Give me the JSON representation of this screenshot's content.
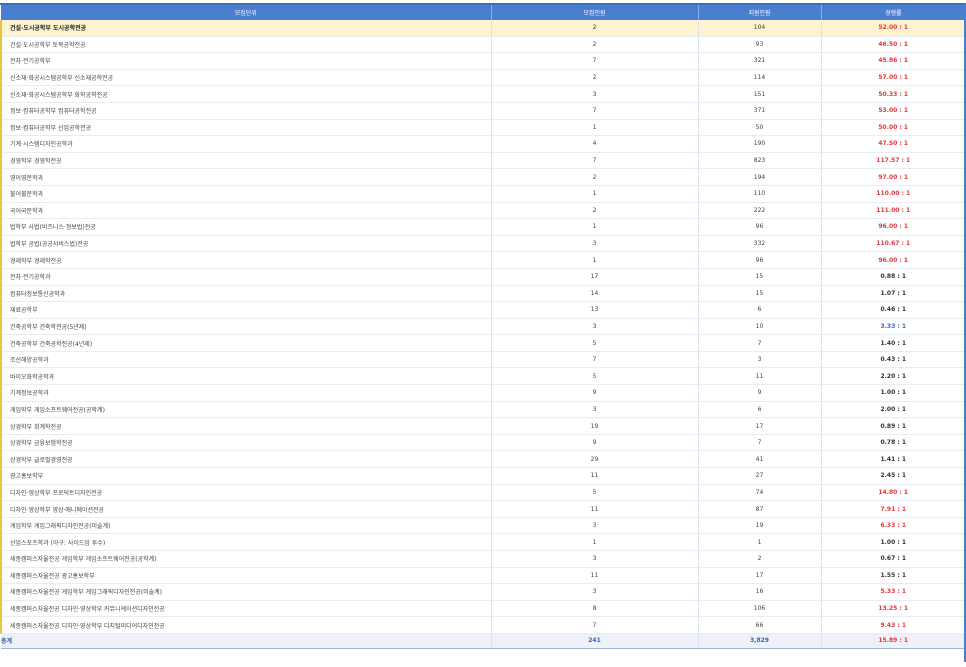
{
  "table": {
    "headers": [
      "모집단위",
      "모집인원",
      "지원인원",
      "경쟁률"
    ],
    "rows": [
      {
        "name": "건설·도시공학부 도시공학전공",
        "quota": "2",
        "applicants": "104",
        "ratio": "52.00 : 1",
        "ratio_color": "red",
        "highlight": true
      },
      {
        "name": "건설·도시공학부 토목공학전공",
        "quota": "2",
        "applicants": "93",
        "ratio": "46.50 : 1",
        "ratio_color": "red"
      },
      {
        "name": "전자·전기공학부",
        "quota": "7",
        "applicants": "321",
        "ratio": "45.86 : 1",
        "ratio_color": "red"
      },
      {
        "name": "신소재·화공시스템공학부 신소재공학전공",
        "quota": "2",
        "applicants": "114",
        "ratio": "57.00 : 1",
        "ratio_color": "red"
      },
      {
        "name": "신소재·화공시스템공학부 화학공학전공",
        "quota": "3",
        "applicants": "151",
        "ratio": "50.33 : 1",
        "ratio_color": "red"
      },
      {
        "name": "정보·컴퓨터공학부 컴퓨터공학전공",
        "quota": "7",
        "applicants": "371",
        "ratio": "53.00 : 1",
        "ratio_color": "red"
      },
      {
        "name": "정보·컴퓨터공학부 산업공학전공",
        "quota": "1",
        "applicants": "50",
        "ratio": "50.00 : 1",
        "ratio_color": "red"
      },
      {
        "name": "기계·시스템디자인공학과",
        "quota": "4",
        "applicants": "190",
        "ratio": "47.50 : 1",
        "ratio_color": "red"
      },
      {
        "name": "경영학부 경영학전공",
        "quota": "7",
        "applicants": "823",
        "ratio": "117.57 : 1",
        "ratio_color": "red",
        "group_start": true
      },
      {
        "name": "영어영문학과",
        "quota": "2",
        "applicants": "194",
        "ratio": "97.00 : 1",
        "ratio_color": "red"
      },
      {
        "name": "불어불문학과",
        "quota": "1",
        "applicants": "110",
        "ratio": "110.00 : 1",
        "ratio_color": "red"
      },
      {
        "name": "국어국문학과",
        "quota": "2",
        "applicants": "222",
        "ratio": "111.00 : 1",
        "ratio_color": "red",
        "group_start": true
      },
      {
        "name": "법학부 사법(비즈니스·정보법)전공",
        "quota": "1",
        "applicants": "96",
        "ratio": "96.00 : 1",
        "ratio_color": "red"
      },
      {
        "name": "법학부 공법(공공서비스법)전공",
        "quota": "3",
        "applicants": "332",
        "ratio": "110.67 : 1",
        "ratio_color": "red"
      },
      {
        "name": "경제학부 경제학전공",
        "quota": "1",
        "applicants": "96",
        "ratio": "96.00 : 1",
        "ratio_color": "red",
        "group_start": true
      },
      {
        "name": "전자·전기공학과",
        "quota": "17",
        "applicants": "15",
        "ratio": "0.88 : 1",
        "ratio_color": "black"
      },
      {
        "name": "컴퓨터정보통신공학과",
        "quota": "14",
        "applicants": "15",
        "ratio": "1.07 : 1",
        "ratio_color": "black"
      },
      {
        "name": "재료공학부",
        "quota": "13",
        "applicants": "6",
        "ratio": "0.46 : 1",
        "ratio_color": "black"
      },
      {
        "name": "건축공학부 건축학전공(5년제)",
        "quota": "3",
        "applicants": "10",
        "ratio": "3.33 : 1",
        "ratio_color": "blue"
      },
      {
        "name": "건축공학부 건축공학전공(4년제)",
        "quota": "5",
        "applicants": "7",
        "ratio": "1.40 : 1",
        "ratio_color": "black"
      },
      {
        "name": "조선해양공학과",
        "quota": "7",
        "applicants": "3",
        "ratio": "0.43 : 1",
        "ratio_color": "black"
      },
      {
        "name": "바이오화학공학과",
        "quota": "5",
        "applicants": "11",
        "ratio": "2.20 : 1",
        "ratio_color": "black"
      },
      {
        "name": "기계정보공학과",
        "quota": "9",
        "applicants": "9",
        "ratio": "1.00 : 1",
        "ratio_color": "black"
      },
      {
        "name": "게임학부 게임소프트웨어전공(공학계)",
        "quota": "3",
        "applicants": "6",
        "ratio": "2.00 : 1",
        "ratio_color": "black"
      },
      {
        "name": "상경학부 회계학전공",
        "quota": "19",
        "applicants": "17",
        "ratio": "0.89 : 1",
        "ratio_color": "black"
      },
      {
        "name": "상경학부 금융보험학전공",
        "quota": "9",
        "applicants": "7",
        "ratio": "0.78 : 1",
        "ratio_color": "black"
      },
      {
        "name": "상경학부 글로벌경영전공",
        "quota": "29",
        "applicants": "41",
        "ratio": "1.41 : 1",
        "ratio_color": "black"
      },
      {
        "name": "광고홍보학부",
        "quota": "11",
        "applicants": "27",
        "ratio": "2.45 : 1",
        "ratio_color": "black"
      },
      {
        "name": "디자인·영상학부 프로덕트디자인전공",
        "quota": "5",
        "applicants": "74",
        "ratio": "14.80 : 1",
        "ratio_color": "red"
      },
      {
        "name": "디자인·영상학부 영상·애니메이션전공",
        "quota": "11",
        "applicants": "87",
        "ratio": "7.91 : 1",
        "ratio_color": "red"
      },
      {
        "name": "게임학부 게임그래픽디자인전공(미술계)",
        "quota": "3",
        "applicants": "19",
        "ratio": "6.33 : 1",
        "ratio_color": "red"
      },
      {
        "name": "산업스포츠학과 (야구: 사이드암 투수)",
        "quota": "1",
        "applicants": "1",
        "ratio": "1.00 : 1",
        "ratio_color": "black"
      },
      {
        "name": "세종캠퍼스자율전공 게임학부 게임소프트웨어전공(공학계)",
        "quota": "3",
        "applicants": "2",
        "ratio": "0.67 : 1",
        "ratio_color": "black"
      },
      {
        "name": "세종캠퍼스자율전공 광고홍보학부",
        "quota": "11",
        "applicants": "17",
        "ratio": "1.55 : 1",
        "ratio_color": "black"
      },
      {
        "name": "세종캠퍼스자율전공 게임학부 게임그래픽디자인전공(미술계)",
        "quota": "3",
        "applicants": "16",
        "ratio": "5.33 : 1",
        "ratio_color": "red"
      },
      {
        "name": "세종캠퍼스자율전공 디자인·영상학부 커뮤니케이션디자인전공",
        "quota": "8",
        "applicants": "106",
        "ratio": "13.25 : 1",
        "ratio_color": "red"
      },
      {
        "name": "세종캠퍼스자율전공 디자인·영상학부 디지털미디어디자인전공",
        "quota": "7",
        "applicants": "66",
        "ratio": "9.43 : 1",
        "ratio_color": "red"
      }
    ],
    "total": {
      "label": "총계",
      "quota": "241",
      "applicants": "3,829",
      "ratio": "15.89 : 1"
    }
  },
  "colors": {
    "header_bg": "#4a7fd0",
    "highlight_row": "#fdf3cf",
    "ratio_red": "#e0383e",
    "ratio_blue": "#3567c8",
    "total_text": "#3a63b7"
  }
}
